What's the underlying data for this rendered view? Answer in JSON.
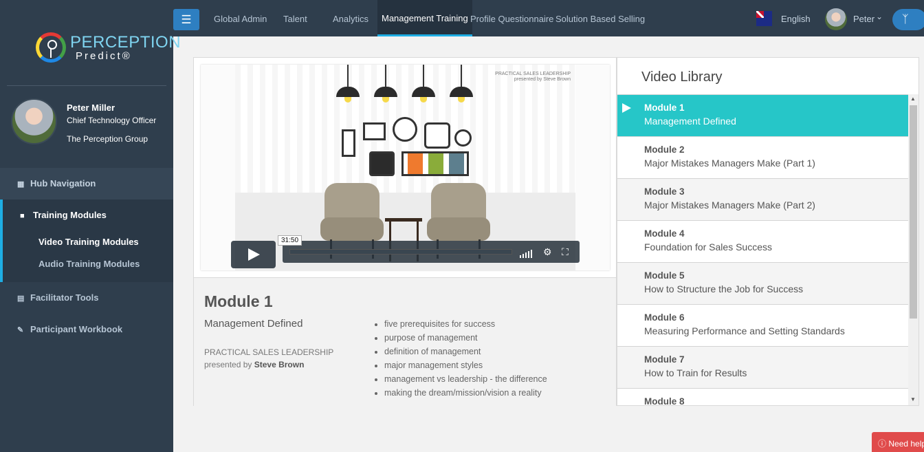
{
  "brand": {
    "logo_line1": "PERCEPTION",
    "logo_line2": "Predict®"
  },
  "profile": {
    "name": "Peter Miller",
    "role": "Chief Technology Officer",
    "org": "The Perception Group"
  },
  "sidebar": {
    "hub": "Hub Navigation",
    "training": "Training Modules",
    "video_modules": "Video Training Modules",
    "audio_modules": "Audio Training Modules",
    "facilitator": "Facilitator Tools",
    "workbook": "Participant Workbook"
  },
  "topnav": {
    "tabs": [
      "Global Admin",
      "Talent",
      "Analytics",
      "Management Training",
      "Profile Questionnaire",
      "Solution Based Selling"
    ],
    "active_tab": "Management Training",
    "language": "English",
    "user": "Peter"
  },
  "video": {
    "watermark_line1": "PRACTICAL SALES LEADERSHIP",
    "watermark_line2": "presented by Steve Brown",
    "timecode": "31:50"
  },
  "module": {
    "title": "Module 1",
    "subtitle": "Management Defined",
    "series": "PRACTICAL SALES LEADERSHIP",
    "presented_by": "presented by",
    "presenter": "Steve Brown",
    "topics": [
      "five prerequisites for success",
      "purpose of management",
      "definition of management",
      "major management styles",
      "management vs leadership - the difference",
      "making the dream/mission/vision a reality"
    ]
  },
  "library": {
    "title": "Video Library",
    "items": [
      {
        "module": "Module 1",
        "title": "Management Defined"
      },
      {
        "module": "Module 2",
        "title": "Major Mistakes Managers Make (Part 1)"
      },
      {
        "module": "Module 3",
        "title": "Major Mistakes Managers Make (Part 2)"
      },
      {
        "module": "Module 4",
        "title": "Foundation for Sales Success"
      },
      {
        "module": "Module 5",
        "title": "How to Structure the Job for Success"
      },
      {
        "module": "Module 6",
        "title": "Measuring Performance and Setting Standards"
      },
      {
        "module": "Module 7",
        "title": "How to Train for Results"
      },
      {
        "module": "Module 8",
        "title": ""
      }
    ]
  },
  "help": {
    "label": "Need help"
  },
  "colors": {
    "sidebar": "#2f3e4d",
    "accent": "#1eaee4",
    "active_item": "#26c6c8",
    "help": "#e04b4b"
  }
}
